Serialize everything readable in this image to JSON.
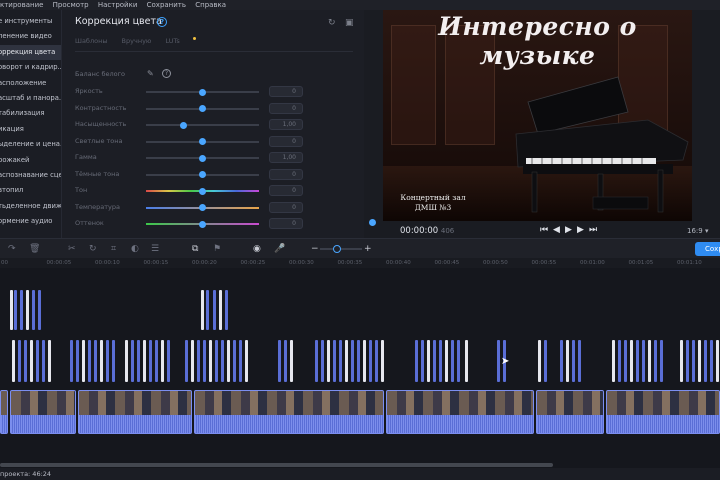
{
  "menu": [
    "ктирование",
    "Просмотр",
    "Настройки",
    "Сохранить",
    "Справка"
  ],
  "sidebar": {
    "items": [
      {
        "label": "е инструменты"
      },
      {
        "label": "ленение видео"
      },
      {
        "label": "оррекция цвета",
        "active": true
      },
      {
        "label": "оворот и кадрир..."
      },
      {
        "label": "асположение"
      },
      {
        "label": "асштаб и панора..."
      },
      {
        "label": "табилизация"
      },
      {
        "label": "икация"
      },
      {
        "label": "ыделение и цена..."
      },
      {
        "label": "рожакей"
      },
      {
        "label": "аспознавание сцен"
      },
      {
        "label": "втопил"
      },
      {
        "label": "тьделенное движ..."
      },
      {
        "label": "ормение аудио"
      }
    ]
  },
  "panel": {
    "title": "Коррекция цвета",
    "help": "?",
    "tabs": [
      "Шаблоны",
      "Вручную",
      "LUTs"
    ],
    "white_balance": "Баланс белого",
    "sliders": [
      {
        "label": "Яркость",
        "value": "0",
        "level": 0.5,
        "style": "plain"
      },
      {
        "label": "Контрастность",
        "value": "0",
        "level": 0.5,
        "style": "plain"
      },
      {
        "label": "Насыщенность",
        "value": "1,00",
        "level": 0.33,
        "style": "plain"
      },
      {
        "label": "Светлые тона",
        "value": "0",
        "level": 0.5,
        "style": "plain"
      },
      {
        "label": "Гамма",
        "value": "1,00",
        "level": 0.5,
        "style": "plain"
      },
      {
        "label": "Тёмные тона",
        "value": "0",
        "level": 0.5,
        "style": "plain"
      },
      {
        "label": "Тон",
        "value": "0",
        "level": 0.5,
        "style": "tone"
      },
      {
        "label": "Температура",
        "value": "0",
        "level": 0.5,
        "style": "temp"
      },
      {
        "label": "Оттенок",
        "value": "0",
        "level": 0.5,
        "style": "tint"
      }
    ]
  },
  "preview": {
    "title_line1": "Интересно  о",
    "title_line2": "музыке",
    "caption_line1": "Концертный зал",
    "caption_line2": "ДМШ №3",
    "timecode": "00:00:00",
    "timecode_ms": "406",
    "aspect": "16:9 ▾"
  },
  "toolbar": {
    "save_label": "Сохр"
  },
  "ruler": [
    "00",
    "00:00:05",
    "00:00:10",
    "00:00:15",
    "00:00:20",
    "00:00:25",
    "00:00:30",
    "00:00:35",
    "00:00:40",
    "00:00:45",
    "00:00:50",
    "00:00:55",
    "00:01:00",
    "00:01:05",
    "00:01:10"
  ],
  "status": {
    "label": "проекта: 46:24"
  },
  "colors": {
    "accent": "#4aa6ff",
    "clip": "#5a6ed6",
    "save": "#2f8cf2"
  }
}
